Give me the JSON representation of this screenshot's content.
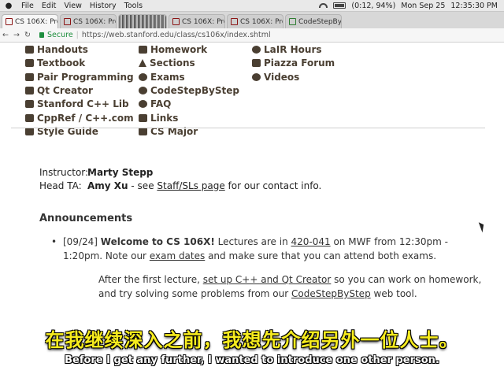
{
  "menubar": {
    "items": [
      "File",
      "Edit",
      "View",
      "History",
      "Tools"
    ],
    "battery": "(0:12, 94%)",
    "date": "Mon Sep 25",
    "time": "12:35:30 PM"
  },
  "tabs": [
    {
      "label": "CS 106X: Pro",
      "active": true
    },
    {
      "label": "CS 106X: Pro",
      "active": false
    },
    {
      "label": "CS 106X: Pro",
      "active": false
    },
    {
      "label": "CS 106X: Pro",
      "active": false
    },
    {
      "label": "CodeStepBy",
      "active": false
    }
  ],
  "address": {
    "secure_label": "Secure",
    "url": "https://web.stanford.edu/class/cs106x/index.shtml"
  },
  "links": {
    "col1": [
      "Handouts",
      "Textbook",
      "Pair Programming",
      "Qt Creator",
      "Stanford C++ Lib",
      "CppRef / C++.com",
      "Style Guide"
    ],
    "col2": [
      "Homework",
      "Sections",
      "Exams",
      "CodeStepByStep",
      "FAQ",
      "Links",
      "CS Major"
    ],
    "col3": [
      "LaIR Hours",
      "Piazza Forum",
      "Videos"
    ]
  },
  "staff": {
    "instructor_label": "Instructor:",
    "instructor_name": "Marty Stepp",
    "ta_label": "Head TA:",
    "ta_name": "Amy Xu",
    "ta_see": " - see ",
    "staff_link": "Staff/SLs page",
    "ta_suffix": " for our contact info."
  },
  "announcements": {
    "title": "Announcements",
    "bullet": "•",
    "date": "[09/24]",
    "welcome": "Welcome to CS 106X!",
    "t1": " Lectures are in ",
    "room": "420-041",
    "t2": " on MWF from 12:30pm - 1:20pm. Note our ",
    "exam_link": "exam dates",
    "t3": " and make sure that you can attend both exams.",
    "t4": "After the first lecture, ",
    "setup_link": "set up C++ and Qt Creator",
    "t5": " so you can work on homework, and try solving some problems from our ",
    "csbs_link": "CodeStepByStep",
    "t6": " web tool."
  },
  "subtitles": {
    "zh": "在我继续深入之前，我想先介绍另外一位人士。",
    "en": "Before I get any further, I wanted to introduce one other person."
  }
}
